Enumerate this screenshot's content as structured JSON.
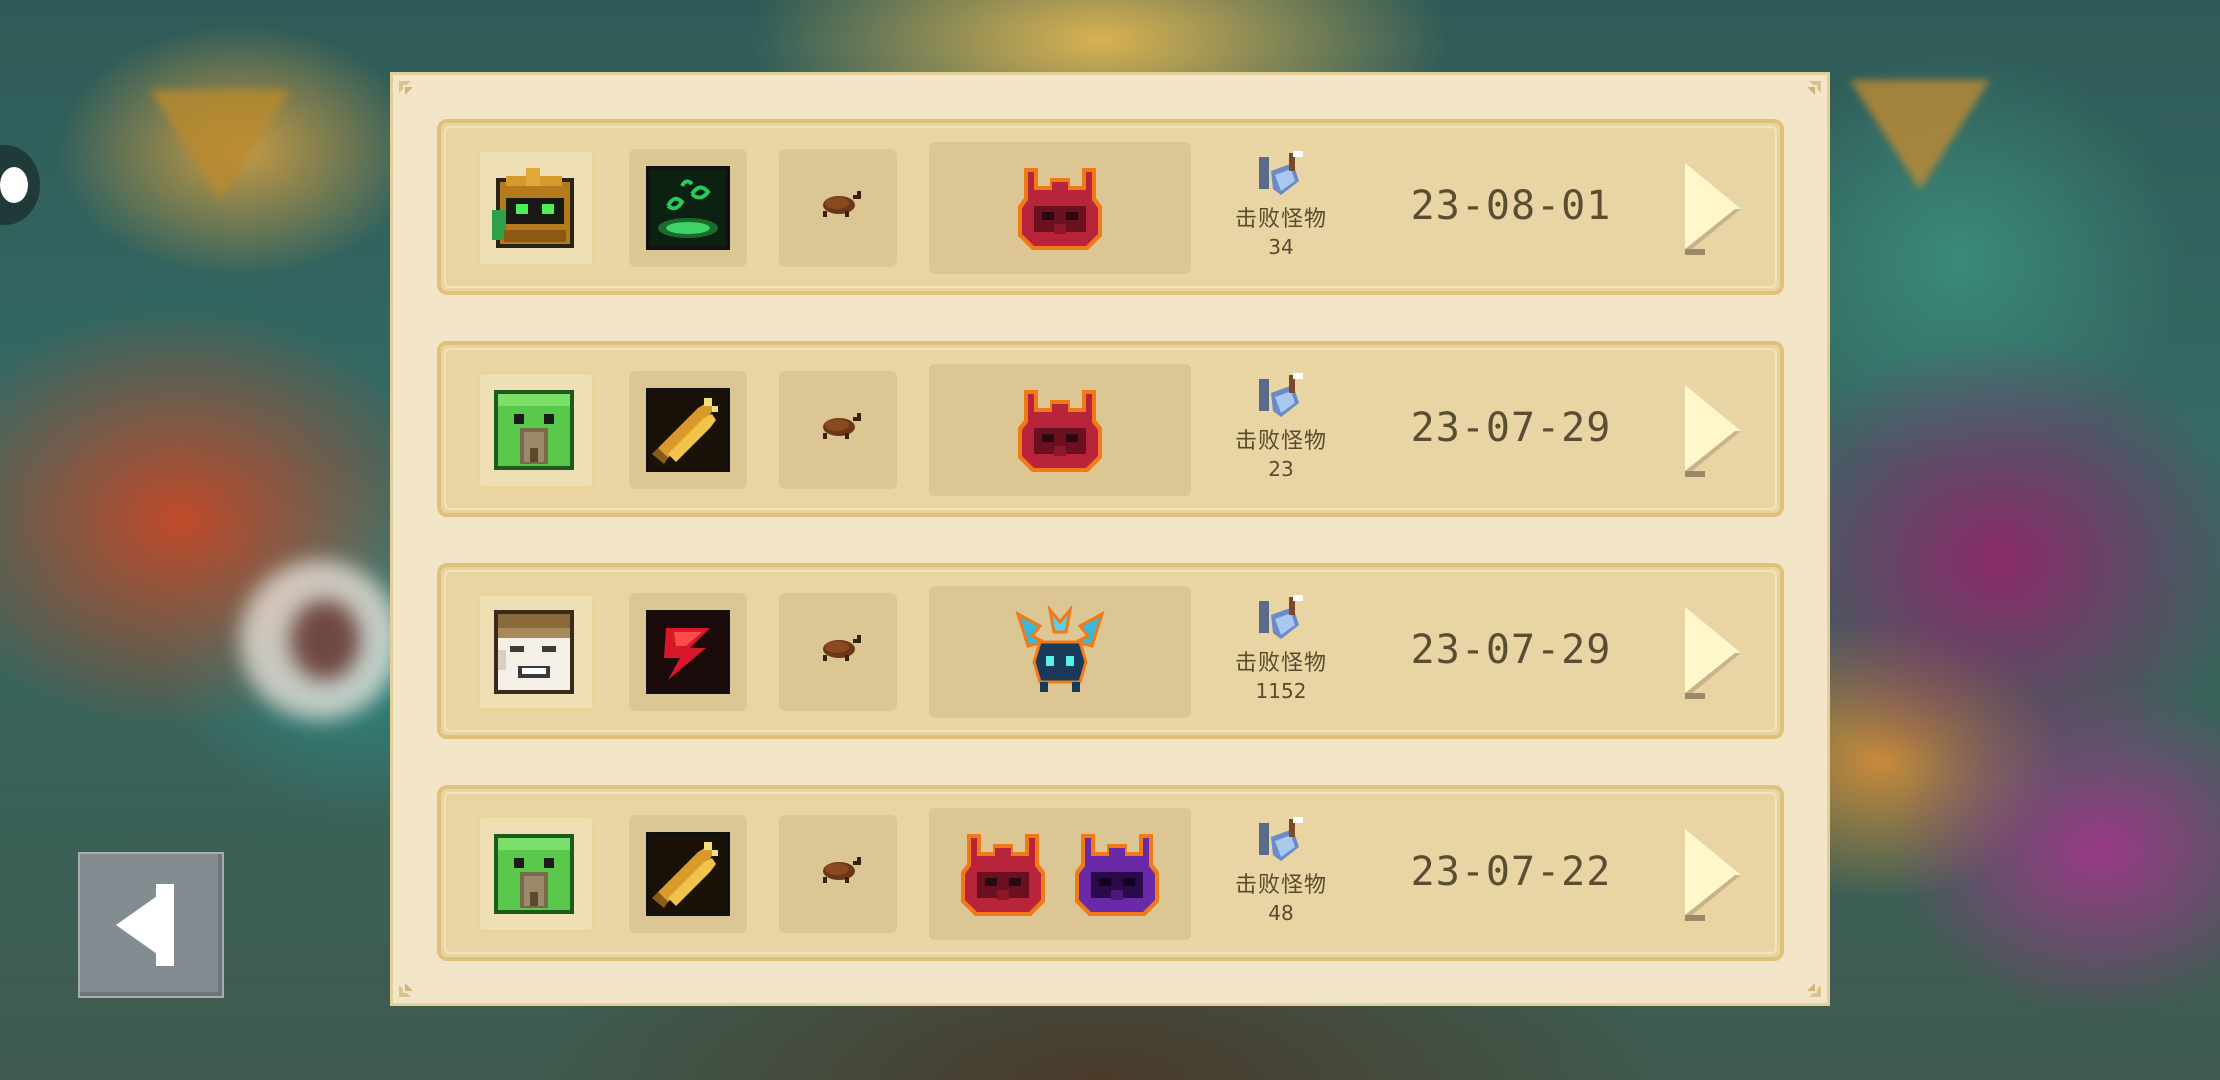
{
  "records": [
    {
      "hero_icon": "knight-helmet-icon",
      "weapon_icon": "green-vortex-skill-icon",
      "pet_icon": "beetle-pet-icon",
      "bosses": [
        "red-horned-demon-icon"
      ],
      "stat_icon": "sword-shield-icon",
      "stat_label": "击败怪物",
      "kills": "34",
      "date": "23-08-01"
    },
    {
      "hero_icon": "green-elf-icon",
      "weapon_icon": "golden-guns-icon",
      "pet_icon": "beetle-pet-icon",
      "bosses": [
        "red-horned-demon-icon"
      ],
      "stat_icon": "sword-shield-icon",
      "stat_label": "击败怪物",
      "kills": "23",
      "date": "23-07-29"
    },
    {
      "hero_icon": "meme-face-icon",
      "weapon_icon": "red-slash-skill-icon",
      "pet_icon": "beetle-pet-icon",
      "bosses": [
        "blue-crystal-beetle-icon"
      ],
      "stat_icon": "sword-shield-icon",
      "stat_label": "击败怪物",
      "kills": "1152",
      "date": "23-07-29"
    },
    {
      "hero_icon": "green-elf-icon",
      "weapon_icon": "golden-guns-icon",
      "pet_icon": "beetle-pet-icon",
      "bosses": [
        "red-horned-demon-icon",
        "purple-horned-demon-icon"
      ],
      "stat_icon": "sword-shield-icon",
      "stat_label": "击败怪物",
      "kills": "48",
      "date": "23-07-22"
    }
  ],
  "back_button_icon": "back-arrow-icon",
  "row_button_icon": "play-arrow-icon"
}
